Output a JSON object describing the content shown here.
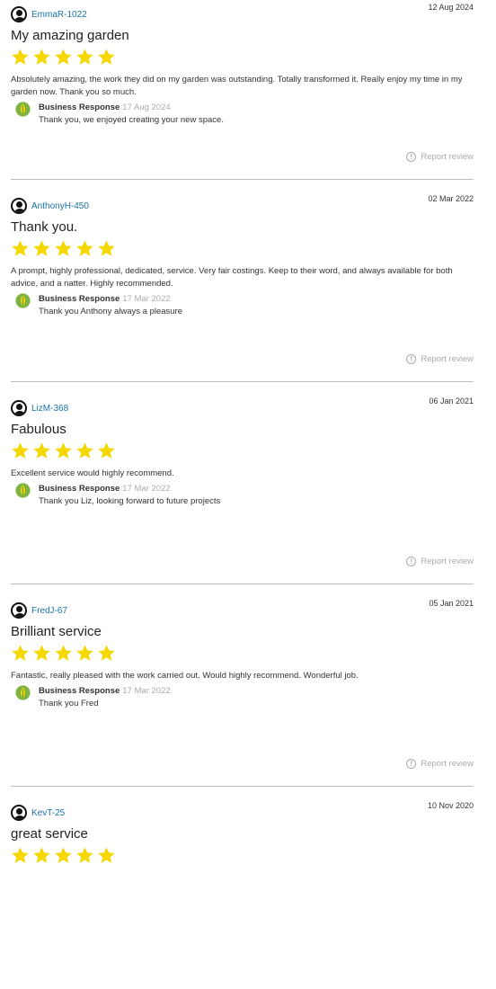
{
  "colors": {
    "star": "#f5d800",
    "username": "#1a73a8",
    "muted": "#aaaaaa",
    "divider": "#bdbdbd"
  },
  "report_label": "Report review",
  "response_label": "Business Response",
  "reviews": [
    {
      "user": "EmmaR-1022",
      "date": "12 Aug 2024",
      "title": "My amazing garden",
      "rating": 5,
      "text": "Absolutely amazing, the work they did on my garden was outstanding. Totally transformed it. Really enjoy my time in my garden now. Thank you so much.",
      "response_date": "17 Aug 2024",
      "response_text": "Thank you, we enjoyed creating your new space."
    },
    {
      "user": "AnthonyH-450",
      "date": "02 Mar 2022",
      "title": "Thank you.",
      "rating": 5,
      "text": "A prompt, highly professional, dedicated, service. Very fair costings. Keep to their word, and always available for both advice, and a natter. Highly recommended.",
      "response_date": "17 Mar 2022",
      "response_text": "Thank you Anthony always a pleasure"
    },
    {
      "user": "LizM-368",
      "date": "06 Jan 2021",
      "title": "Fabulous",
      "rating": 5,
      "text": "Excellent service would highly recommend.",
      "response_date": "17 Mar 2022",
      "response_text": "Thank you Liz, looking forward to future projects"
    },
    {
      "user": "FredJ-67",
      "date": "05 Jan 2021",
      "title": "Brilliant service",
      "rating": 5,
      "text": "Fantastic, really pleased with the work carried out. Would highly recommend. Wonderful job.",
      "response_date": "17 Mar 2022",
      "response_text": "Thank you Fred"
    },
    {
      "user": "KevT-25",
      "date": "10 Nov 2020",
      "title": "great service",
      "rating": 5
    }
  ]
}
